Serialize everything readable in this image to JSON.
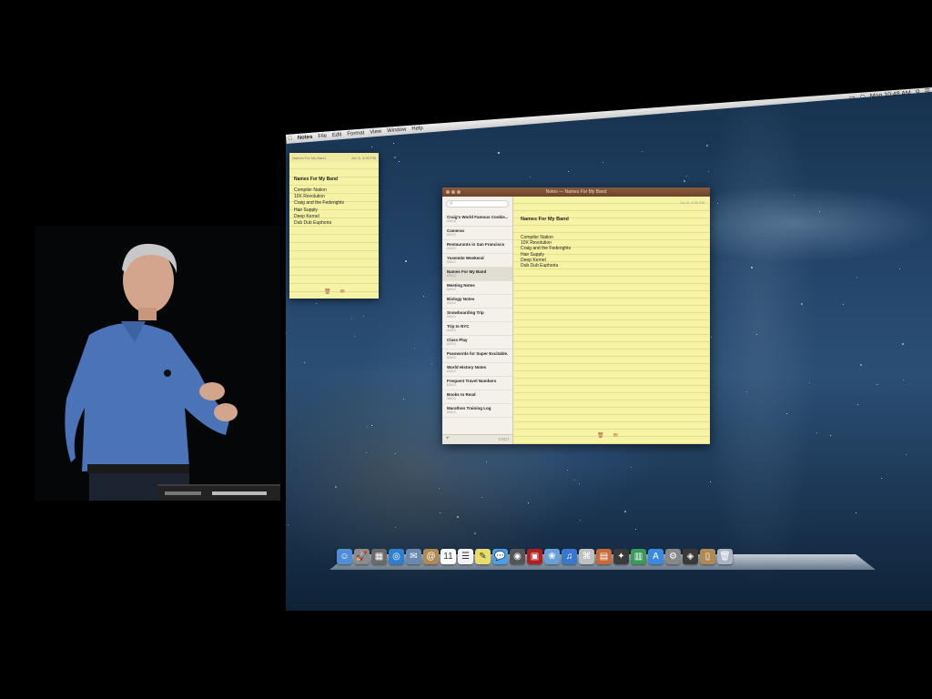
{
  "menubar": {
    "apple": "",
    "items": [
      "Notes",
      "File",
      "Edit",
      "Format",
      "View",
      "Window",
      "Help"
    ],
    "clock": "Mon 10:48 AM"
  },
  "sticky": {
    "header": "Names For My Band",
    "date": "Jun 5, 4:00 PM",
    "title": "Names For My Band",
    "lines": [
      "Compiler Nation",
      "10X Revolution",
      "Craig and the Federights",
      "Hair Supply",
      "Deep Kernel",
      "Dub Dub Euphoria"
    ]
  },
  "notes_window": {
    "title": "Notes — Names For My Band",
    "search_placeholder": "",
    "date": "Jun 5, 4:00 PM",
    "note_title": "Names For My Band",
    "note_lines": [
      "Compiler Nation",
      "10X Revolution",
      "Craig and the Federights",
      "Hair Supply",
      "Deep Kernel",
      "Dub Dub Euphoria"
    ],
    "notes_list": [
      {
        "title": "Craig's World Famous Cookie...",
        "date": "6/5/13"
      },
      {
        "title": "Cameras",
        "date": "6/5/13"
      },
      {
        "title": "Restaurants in San Francisco",
        "date": "6/5/13"
      },
      {
        "title": "Yosemite Weekend",
        "date": "6/5/13"
      },
      {
        "title": "Names For My Band",
        "date": "6/5/13"
      },
      {
        "title": "Meeting Notes",
        "date": "6/5/13"
      },
      {
        "title": "Biology Notes",
        "date": "6/5/13"
      },
      {
        "title": "Snowboarding Trip",
        "date": "6/5/13"
      },
      {
        "title": "Trip to NYC",
        "date": "6/5/13"
      },
      {
        "title": "Class Play",
        "date": "6/5/13"
      },
      {
        "title": "Passwords for Super Excitable...",
        "date": "6/5/13"
      },
      {
        "title": "World History Notes",
        "date": "6/5/13"
      },
      {
        "title": "Frequent Travel Numbers",
        "date": "6/5/13"
      },
      {
        "title": "Books to Read",
        "date": "6/5/13"
      },
      {
        "title": "Marathon Training Log",
        "date": "6/5/13"
      }
    ],
    "add_label": "+",
    "trash_icon": "🗑",
    "share_icon": "✉"
  },
  "dock": [
    {
      "name": "finder-icon",
      "color": "#4f8fd8",
      "glyph": "☺"
    },
    {
      "name": "launchpad-icon",
      "color": "#8c8c8c",
      "glyph": "🚀"
    },
    {
      "name": "mission-control-icon",
      "color": "#6a6a6a",
      "glyph": "▦"
    },
    {
      "name": "safari-icon",
      "color": "#2f7fd0",
      "glyph": "◎"
    },
    {
      "name": "mail-icon",
      "color": "#6a88b0",
      "glyph": "✉"
    },
    {
      "name": "contacts-icon",
      "color": "#b08a54",
      "glyph": "@"
    },
    {
      "name": "calendar-icon",
      "color": "#ffffff",
      "glyph": "11"
    },
    {
      "name": "reminders-icon",
      "color": "#f2f2f2",
      "glyph": "☰"
    },
    {
      "name": "notes-icon",
      "color": "#e8dc6a",
      "glyph": "✎"
    },
    {
      "name": "messages-icon",
      "color": "#4aa0e8",
      "glyph": "💬"
    },
    {
      "name": "facetime-icon",
      "color": "#555555",
      "glyph": "◉"
    },
    {
      "name": "photo-booth-icon",
      "color": "#b02020",
      "glyph": "▣"
    },
    {
      "name": "iphoto-icon",
      "color": "#6aa0d8",
      "glyph": "❀"
    },
    {
      "name": "itunes-icon",
      "color": "#3a78d0",
      "glyph": "♫"
    },
    {
      "name": "preview-icon",
      "color": "#c0c0c0",
      "glyph": "⌘"
    },
    {
      "name": "photo-slideshow-icon",
      "color": "#c86a3a",
      "glyph": "▤"
    },
    {
      "name": "aperture-icon",
      "color": "#3a3a3a",
      "glyph": "✦"
    },
    {
      "name": "numbers-icon",
      "color": "#3a9a5a",
      "glyph": "▥"
    },
    {
      "name": "app-store-icon",
      "color": "#3a8ae0",
      "glyph": "A"
    },
    {
      "name": "system-preferences-icon",
      "color": "#888888",
      "glyph": "⚙"
    },
    {
      "name": "game-center-icon",
      "color": "#3a3a3a",
      "glyph": "◈"
    },
    {
      "name": "documents-folder-icon",
      "color": "#b08a54",
      "glyph": "▯"
    },
    {
      "name": "trash-icon",
      "color": "#a8b4c0",
      "glyph": "🗑"
    }
  ]
}
